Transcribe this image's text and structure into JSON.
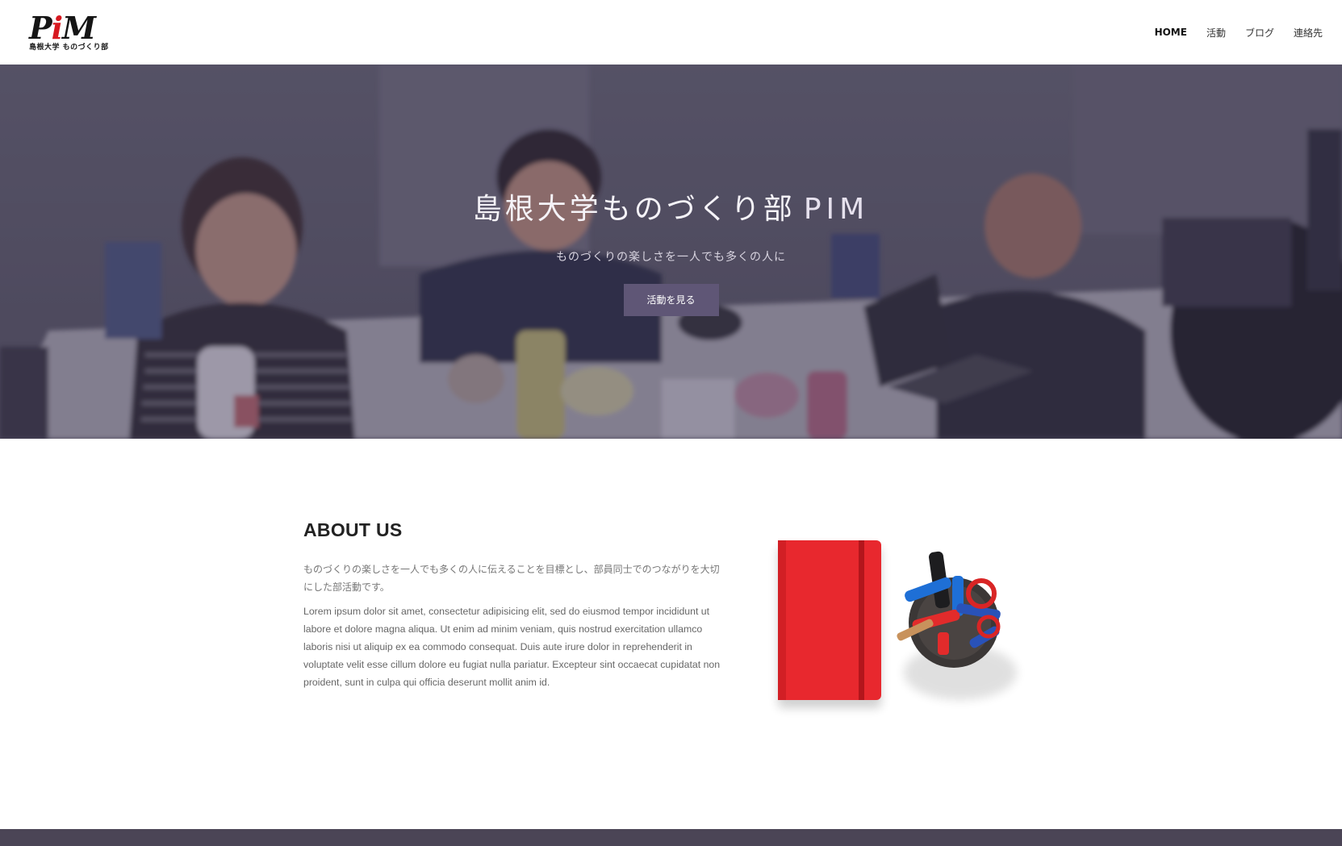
{
  "header": {
    "logo_text": "PiM",
    "logo_subtitle": "島根大学 ものづくり部",
    "nav": [
      {
        "label": "HOME",
        "active": true
      },
      {
        "label": "活動",
        "active": false
      },
      {
        "label": "ブログ",
        "active": false
      },
      {
        "label": "連絡先",
        "active": false
      }
    ]
  },
  "hero": {
    "title": "島根大学ものづくり部",
    "title_brand": "PIM",
    "subtitle": "ものづくりの楽しさを一人でも多くの人に",
    "cta_label": "活動を見る"
  },
  "about": {
    "heading": "ABOUT US",
    "intro_jp": "ものづくりの楽しさを一人でも多くの人に伝えることを目標とし、部員同士でのつながりを大切にした部活動です。",
    "body": "Lorem ipsum dolor sit amet, consectetur adipisicing elit, sed do eiusmod tempor incididunt ut labore et dolore magna aliqua. Ut enim ad minim veniam, quis nostrud exercitation ullamco laboris nisi ut aliquip ex ea commodo consequat. Duis aute irure dolor in reprehenderit in voluptate velit esse cillum dolore eu fugiat nulla pariatur. Excepteur sint occaecat cupidatat non proident, sunt in culpa qui officia deserunt mollit anim id."
  },
  "colors": {
    "hero_overlay": "#51485e",
    "cta_button": "#5f5676",
    "notebook_red": "#e8282e",
    "footer": "#4b4556",
    "logo_accent": "#d71920"
  }
}
